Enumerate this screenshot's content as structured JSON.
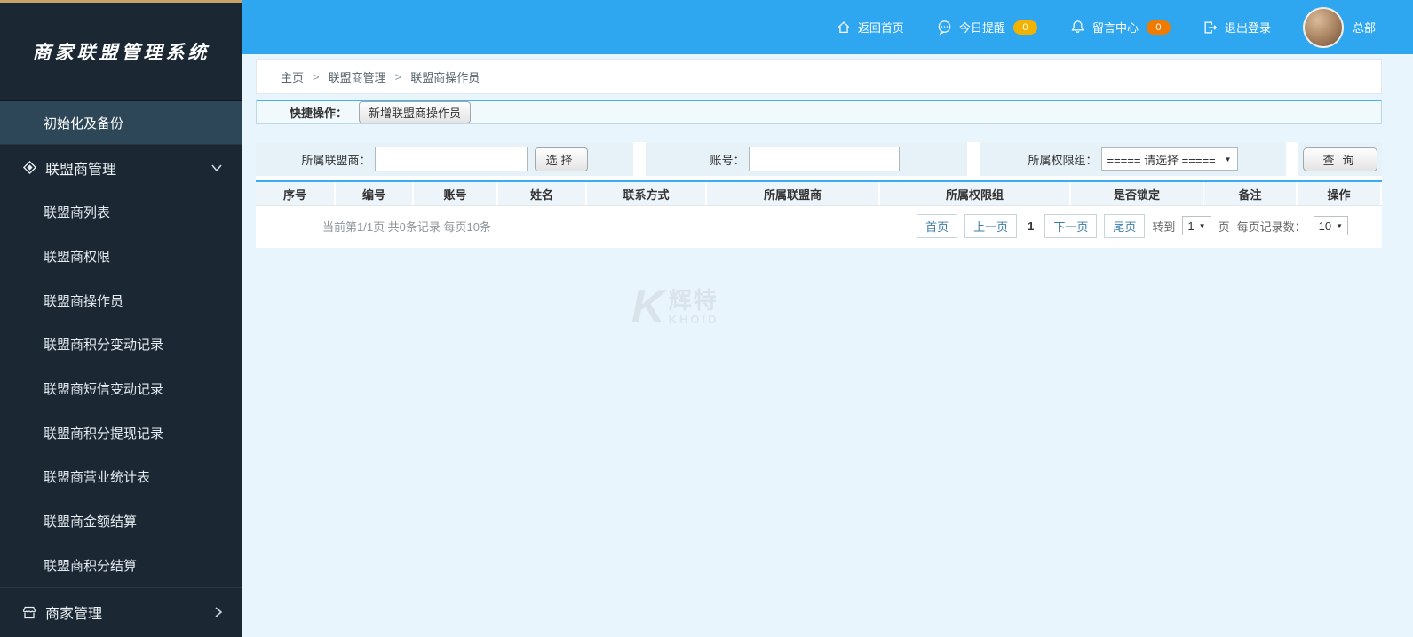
{
  "app": {
    "title": "商家联盟管理系统"
  },
  "topbar": {
    "home": "返回首页",
    "today_reminder": "今日提醒",
    "today_reminder_badge": "0",
    "message_center": "留言中心",
    "message_center_badge": "0",
    "logout": "退出登录",
    "username": "总部"
  },
  "sidebar": {
    "init_backup": "初始化及备份",
    "alliance_section": "联盟商管理",
    "alliance_submenu": [
      "联盟商列表",
      "联盟商权限",
      "联盟商操作员",
      "联盟商积分变动记录",
      "联盟商短信变动记录",
      "联盟商积分提现记录",
      "联盟商营业统计表",
      "联盟商金额结算",
      "联盟商积分结算"
    ],
    "merchant_section": "商家管理"
  },
  "breadcrumb": {
    "home": "主页",
    "sep": ">",
    "level1": "联盟商管理",
    "level2": "联盟商操作员"
  },
  "quickop": {
    "label": "快捷操作：",
    "add_button": "新增联盟商操作员"
  },
  "filters": {
    "alliance_label": "所属联盟商：",
    "alliance_value": "",
    "choose_button": "选择",
    "account_label": "账号：",
    "account_value": "",
    "permission_label": "所属权限组：",
    "permission_selected": "===== 请选择 =====",
    "search_button": "查询"
  },
  "table": {
    "headers": [
      "序号",
      "编号",
      "账号",
      "姓名",
      "联系方式",
      "所属联盟商",
      "所属权限组",
      "是否锁定",
      "备注",
      "操作"
    ]
  },
  "pagination": {
    "summary": "当前第1/1页 共0条记录 每页10条",
    "first": "首页",
    "prev": "上一页",
    "current_page": "1",
    "next": "下一页",
    "last": "尾页",
    "goto_label": "转到",
    "goto_value": "1",
    "goto_unit": "页",
    "page_size_label": "每页记录数：",
    "page_size_value": "10"
  },
  "watermark": {
    "mark": "K",
    "name": "辉特",
    "subtitle": "KHOID"
  },
  "colors": {
    "topbar_blue": "#2ea7f0",
    "sidebar_dark": "#1b2733",
    "sidebar_active": "#2d4758",
    "badge_yellow": "#f2b200",
    "badge_orange": "#f07b00",
    "accent_border_blue": "#44b3f0",
    "content_bg": "#e9f5fd"
  }
}
